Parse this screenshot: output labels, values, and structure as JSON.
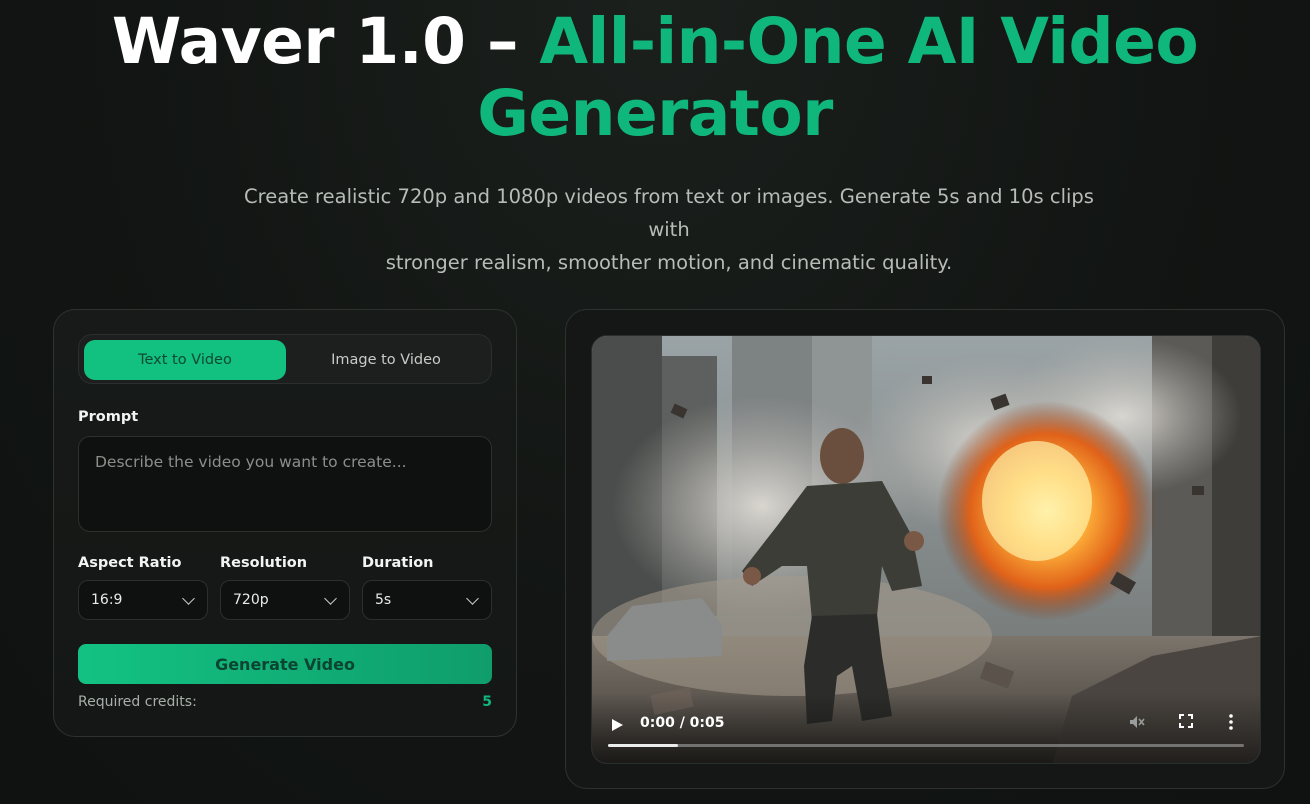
{
  "hero": {
    "title_white": "Waver 1.0 – ",
    "title_green_line1": "All-in-One AI Video",
    "title_green_line2": "Generator",
    "subtitle_line1": "Create realistic 720p and 1080p videos from text or images. Generate 5s and 10s clips with",
    "subtitle_line2": "stronger realism, smoother motion, and cinematic quality."
  },
  "form": {
    "tabs": [
      {
        "label": "Text to Video",
        "active": true
      },
      {
        "label": "Image to Video",
        "active": false
      }
    ],
    "prompt_label": "Prompt",
    "prompt_placeholder": "Describe the video you want to create...",
    "prompt_value": "",
    "aspect_label": "Aspect Ratio",
    "aspect_value": "16:9",
    "resolution_label": "Resolution",
    "resolution_value": "720p",
    "duration_label": "Duration",
    "duration_value": "5s",
    "generate_label": "Generate Video",
    "credits_label": "Required credits:",
    "credits_value": "5"
  },
  "video": {
    "time_display": "0:00 / 0:05",
    "progress": 0.11,
    "icons": [
      "play-icon",
      "mute-icon",
      "fullscreen-icon",
      "more-options-icon"
    ]
  },
  "colors": {
    "accent": "#10b77d",
    "background": "#121513",
    "panel_border": "#2d322f"
  }
}
